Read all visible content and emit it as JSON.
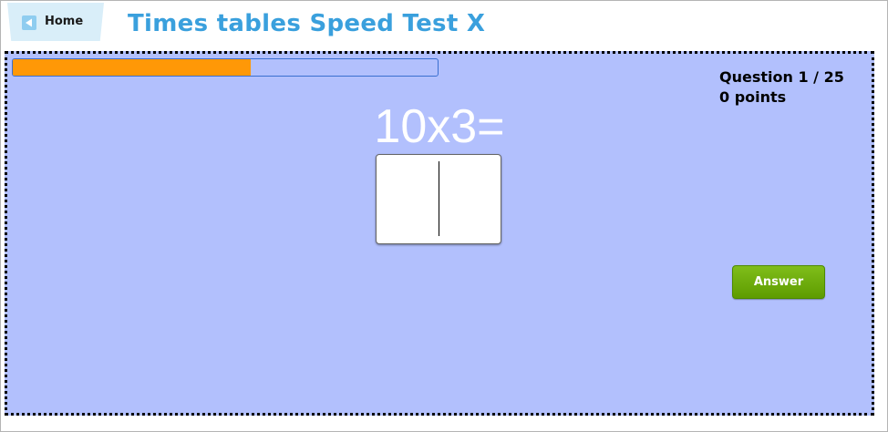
{
  "header": {
    "home_label": "Home",
    "home_icon": "back-arrow-icon",
    "title": "Times tables Speed Test X"
  },
  "game": {
    "progress": 0.56,
    "question_counter": "Question 1 / 25",
    "points": "0 points",
    "question": "10x3=",
    "answer_value": "",
    "answer_button_label": "Answer"
  },
  "colors": {
    "title": "#3aa0dd",
    "panel_background": "#b2c0fd",
    "progress_fill": "#ff9807",
    "answer_button": "#6aaa0a"
  }
}
